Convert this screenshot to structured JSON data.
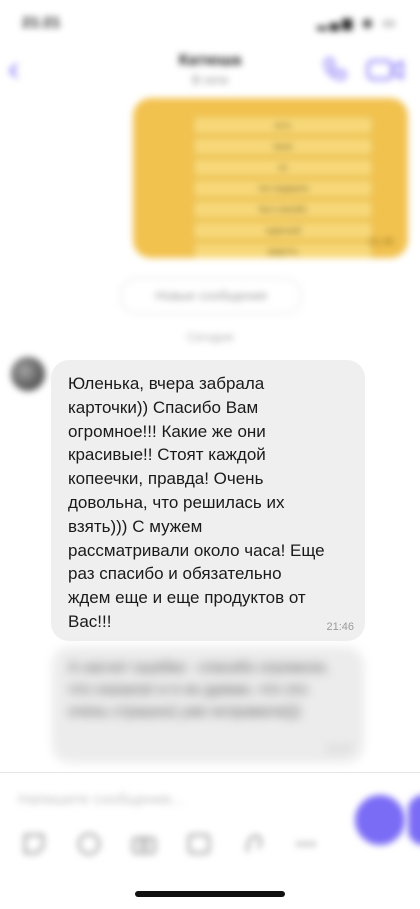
{
  "status_bar": {
    "time": "21:21",
    "icons": "▂▄▆ ◉ ▭"
  },
  "header": {
    "back_glyph": "‹",
    "contact_name": "Катюша",
    "contact_status": "В сети"
  },
  "image_message": {
    "rows": [
      "есть",
      "иные",
      "из",
      "тих подарили",
      "был спасибо",
      "чудесный",
      "радость"
    ],
    "time": "21:45"
  },
  "new_messages_label": "Новые сообщения",
  "day_label": "Сегодня",
  "message": {
    "text": "Юленька, вчера забрала\nкарточки)) Спасибо Вам\nогромное!!! Какие же они\nкрасивые!! Стоят каждой\nкопеечки, правда! Очень\nдовольна, что решилась их\nвзять))) С мужем\nрассматривали около часа! Еще\nраз спасибо и обязательно\nждем еще и еще продуктов от\nВас!!!",
    "time": "21:46"
  },
  "message2": {
    "text": "А насчет ошибки - спасибо огромное, что сказала! и я не думаю, что это очень страшно) уже исправила)))",
    "time": "21:47"
  },
  "composer": {
    "placeholder": "Напишите сообщение..."
  },
  "colors": {
    "accent": "#7b6cf6",
    "image_bg": "#f2c24f",
    "bubble": "#efefef"
  }
}
